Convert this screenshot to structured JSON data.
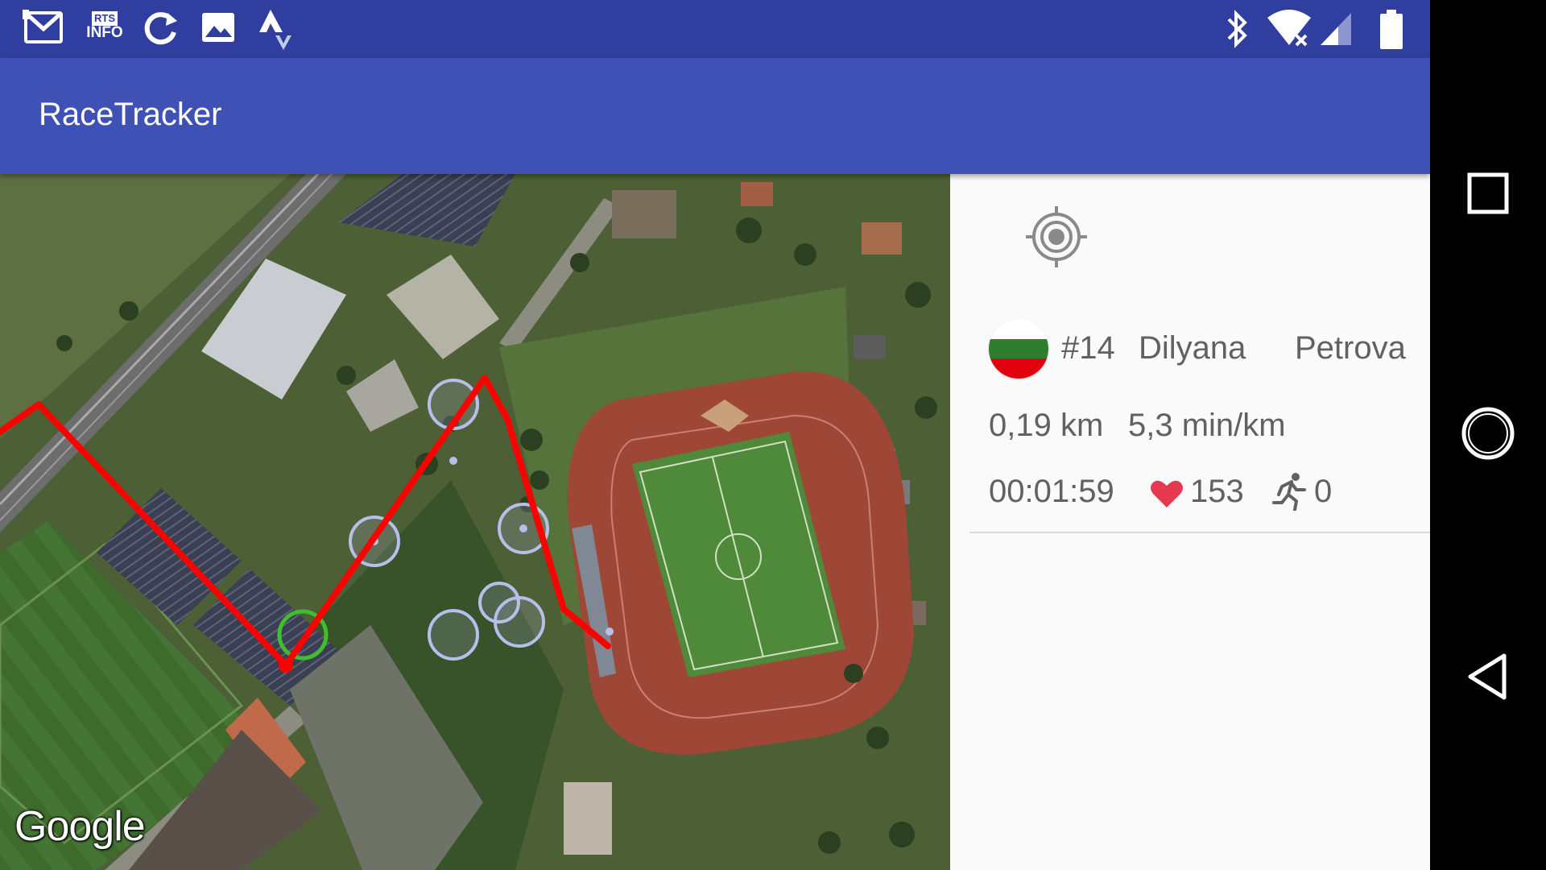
{
  "status_bar": {
    "left_icons": [
      "gmail-icon",
      "rts-info-icon",
      "sync-icon",
      "gallery-icon",
      "strava-icon"
    ],
    "rts_info_top": "RTS",
    "rts_info_bottom": "INFO",
    "right_icons": [
      "bluetooth-icon",
      "wifi-no-internet-icon",
      "cell-signal-icon",
      "battery-icon"
    ]
  },
  "app_bar": {
    "title": "RaceTracker"
  },
  "map": {
    "attribution": "Google",
    "track_color": "#FF0000",
    "checkpoint_color": "#B8BEEA",
    "start_marker_color": "#3FBF2F"
  },
  "runner": {
    "flag_colors": [
      "#FFFFFF",
      "#2F7D2F",
      "#E0000E"
    ],
    "bib": "#14",
    "first_name": "Dilyana",
    "last_name": "Petrova",
    "distance": "0,19 km",
    "pace": "5,3 min/km",
    "elapsed": "00:01:59",
    "heart_rate": "153",
    "cadence": "0",
    "heart_color": "#E53950"
  },
  "nav_bar": {
    "buttons": [
      "recents-button",
      "home-button",
      "back-button"
    ]
  }
}
